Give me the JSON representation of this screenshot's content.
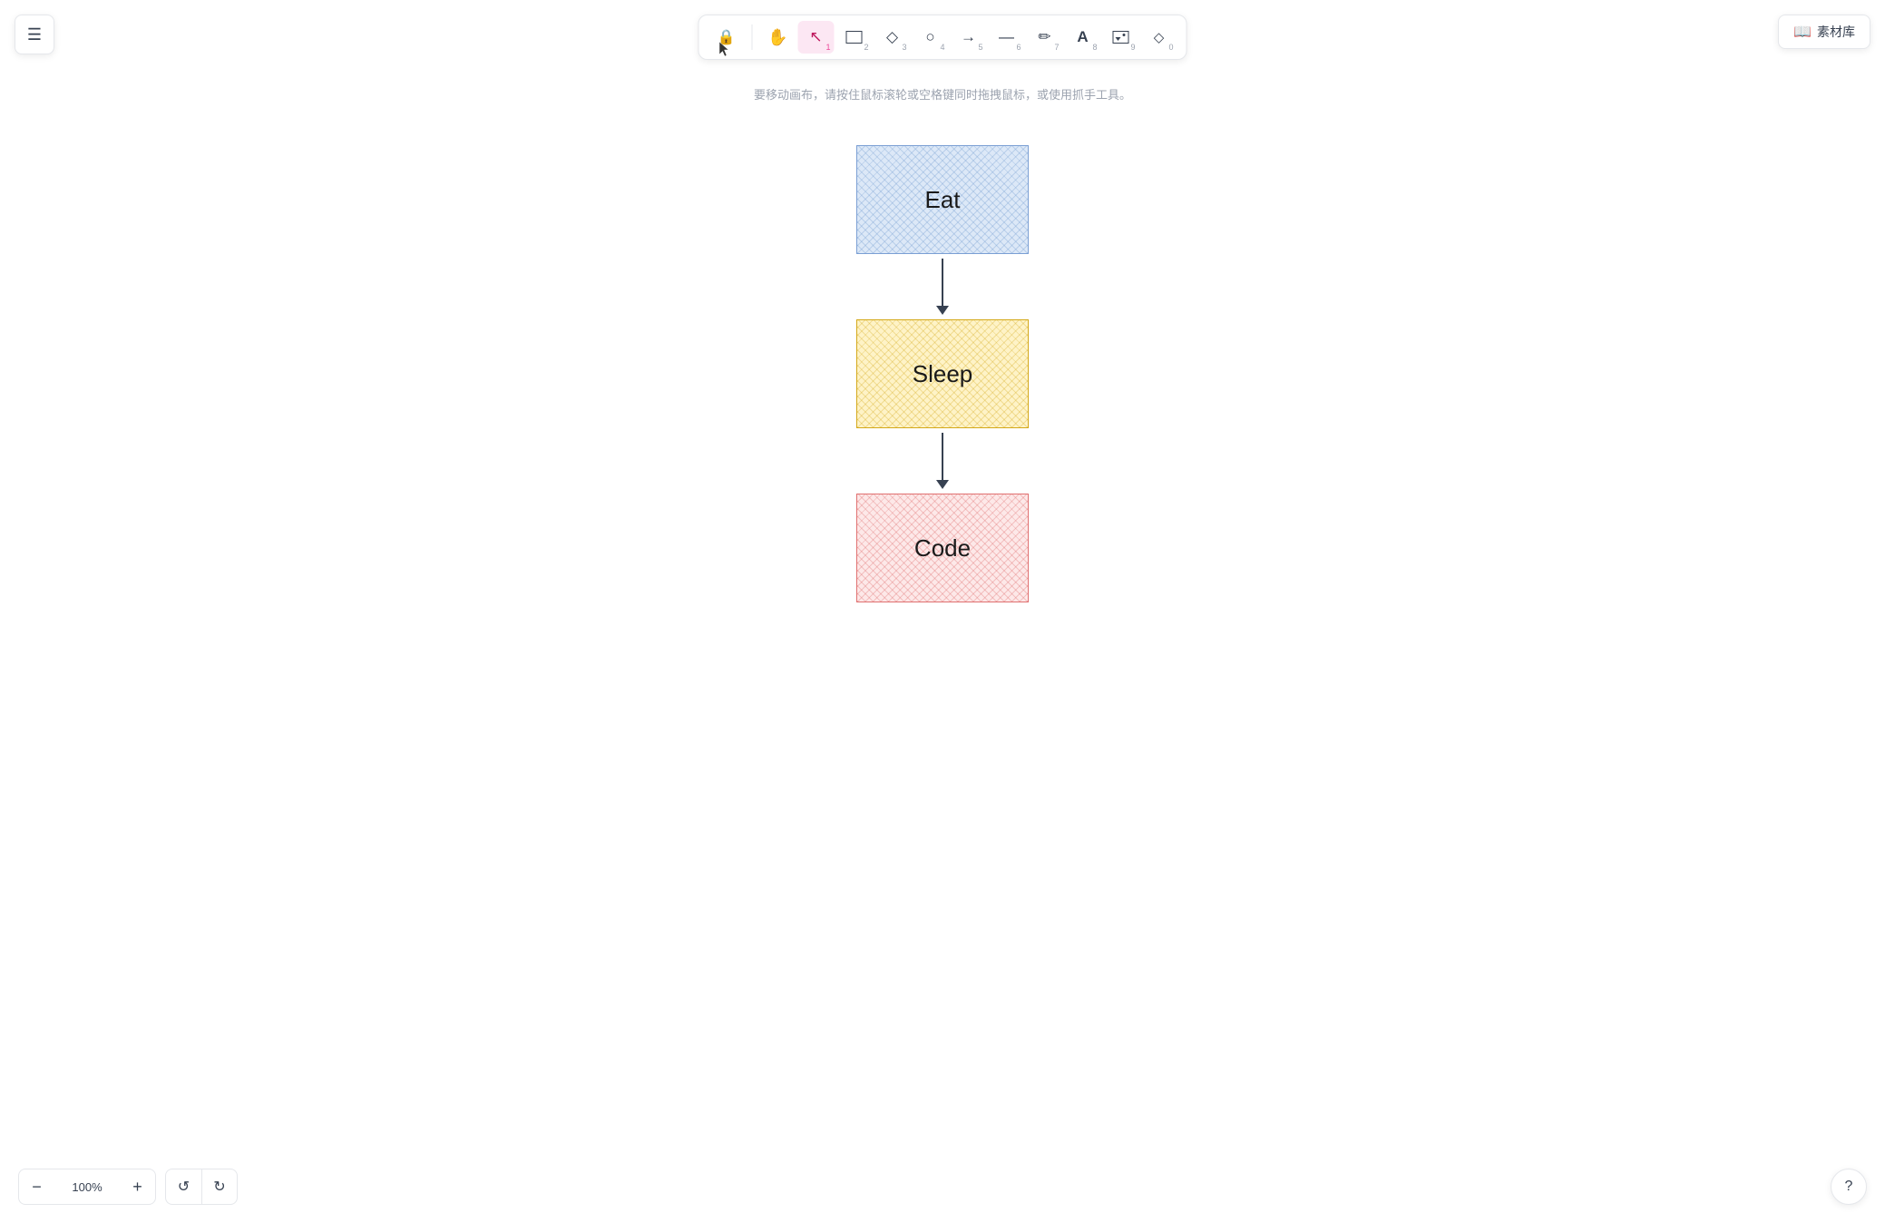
{
  "menu": {
    "icon": "☰",
    "label": "menu"
  },
  "toolbar": {
    "tools": [
      {
        "id": "lock",
        "icon": "🔒",
        "shortcut": "",
        "label": "lock-tool",
        "active": false
      },
      {
        "id": "hand",
        "icon": "✋",
        "shortcut": "",
        "label": "hand-tool",
        "active": false
      },
      {
        "id": "select",
        "icon": "↖",
        "shortcut": "1",
        "label": "select-tool",
        "active": true
      },
      {
        "id": "rect",
        "icon": "□",
        "shortcut": "2",
        "label": "rect-tool",
        "active": false
      },
      {
        "id": "diamond",
        "icon": "◇",
        "shortcut": "3",
        "label": "diamond-tool",
        "active": false
      },
      {
        "id": "ellipse",
        "icon": "○",
        "shortcut": "4",
        "label": "ellipse-tool",
        "active": false
      },
      {
        "id": "arrow",
        "icon": "→",
        "shortcut": "5",
        "label": "arrow-tool",
        "active": false
      },
      {
        "id": "line",
        "icon": "—",
        "shortcut": "6",
        "label": "line-tool",
        "active": false
      },
      {
        "id": "pen",
        "icon": "✏",
        "shortcut": "7",
        "label": "pen-tool",
        "active": false
      },
      {
        "id": "text",
        "icon": "A",
        "shortcut": "8",
        "label": "text-tool",
        "active": false
      },
      {
        "id": "image",
        "icon": "⬜",
        "shortcut": "9",
        "label": "image-tool",
        "active": false
      },
      {
        "id": "eraser",
        "icon": "◇",
        "shortcut": "0",
        "label": "eraser-tool",
        "active": false
      }
    ]
  },
  "library": {
    "icon": "📖",
    "label": "素材库"
  },
  "hint": {
    "text": "要移动画布，请按住鼠标滚轮或空格键同时拖拽鼠标，或使用抓手工具。"
  },
  "flowchart": {
    "nodes": [
      {
        "id": "eat",
        "label": "Eat",
        "color": "blue"
      },
      {
        "id": "sleep",
        "label": "Sleep",
        "color": "yellow"
      },
      {
        "id": "code",
        "label": "Code",
        "color": "pink"
      }
    ]
  },
  "bottom": {
    "zoom_minus": "−",
    "zoom_value": "100%",
    "zoom_plus": "+",
    "undo_icon": "↺",
    "redo_icon": "↻",
    "help_icon": "?"
  }
}
